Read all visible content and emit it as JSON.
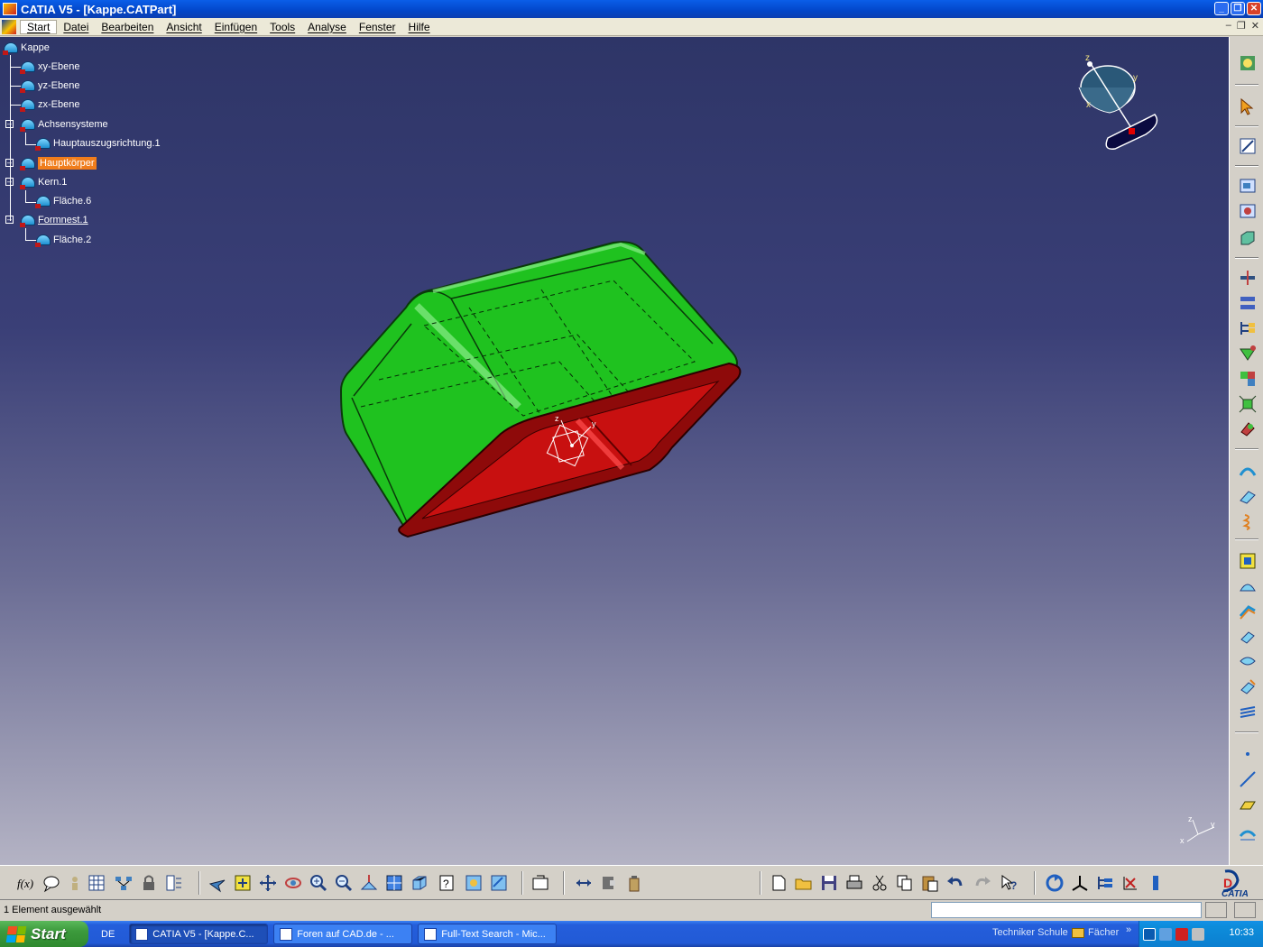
{
  "window": {
    "title": "CATIA V5 - [Kappe.CATPart]"
  },
  "menubar": {
    "items": [
      "Start",
      "Datei",
      "Bearbeiten",
      "Ansicht",
      "Einfügen",
      "Tools",
      "Analyse",
      "Fenster",
      "Hilfe"
    ]
  },
  "tree": {
    "root": "Kappe",
    "nodes": {
      "xy": "xy-Ebene",
      "yz": "yz-Ebene",
      "zx": "zx-Ebene",
      "axes": "Achsensysteme",
      "axis1": "Hauptauszugsrichtung.1",
      "body": "Hauptkörper",
      "core": "Kern.1",
      "face6": "Fläche.6",
      "cavity": "Formnest.1",
      "face2": "Fläche.2"
    }
  },
  "compass": {
    "x": "x",
    "y": "y",
    "z": "z"
  },
  "statusbar": {
    "message": "1 Element ausgewählt",
    "command_value": ""
  },
  "taskbar": {
    "start": "Start",
    "language": "DE",
    "tasks": [
      "CATIA V5 - [Kappe.C...",
      "Foren auf CAD.de - ...",
      "Full-Text Search - Mic..."
    ],
    "toolbar_school": "Techniker Schule",
    "toolbar_folder": "Fächer",
    "chevron": "»",
    "clock": "10:33"
  },
  "colors": {
    "viewport_top": "#2e3567",
    "viewport_bottom": "#b4b3c4",
    "part_green": "#22c422",
    "part_red": "#c01010",
    "highlight": "#f07d1c"
  },
  "icons": {
    "right_toolbar": [
      "sketcher-icon",
      "select-arrow-icon",
      "sketch-icon",
      "surface-tools-icon",
      "parting-icon",
      "box-icon",
      "split-icon",
      "transfer-icon",
      "tree-icon",
      "pulling-direction-icon",
      "core-cavity-icon",
      "explode-icon",
      "aggregate-icon",
      "curve-icon",
      "reflect-line-icon",
      "helix-icon",
      "fill-icon",
      "sweep-icon",
      "offset-icon",
      "extrude-icon",
      "blend-icon",
      "join-icon",
      "multi-surface-icon",
      "point-icon",
      "line-icon",
      "plane-icon",
      "project-icon"
    ],
    "bottom_toolbar": [
      "formula-icon",
      "comment-icon",
      "knowledge-icon",
      "table-icon",
      "graph-icon",
      "lock-icon",
      "measure-icon",
      "fly-icon",
      "fit-all-icon",
      "pan-icon",
      "rotate-icon",
      "zoom-in-icon",
      "zoom-out-icon",
      "normal-view-icon",
      "multi-view-icon",
      "iso-view-icon",
      "help-mode-icon",
      "render-icon",
      "swap-icon",
      "capture-icon",
      "measure-between-icon",
      "measure-item-icon",
      "mass-icon",
      "new-icon",
      "open-icon",
      "save-icon",
      "print-icon",
      "cut-icon",
      "copy-icon",
      "paste-icon",
      "undo-icon",
      "redo-icon",
      "whats-this-icon",
      "update-icon",
      "axis-system-icon",
      "spec-tree-icon",
      "analysis-icon",
      "catia-logo"
    ]
  }
}
